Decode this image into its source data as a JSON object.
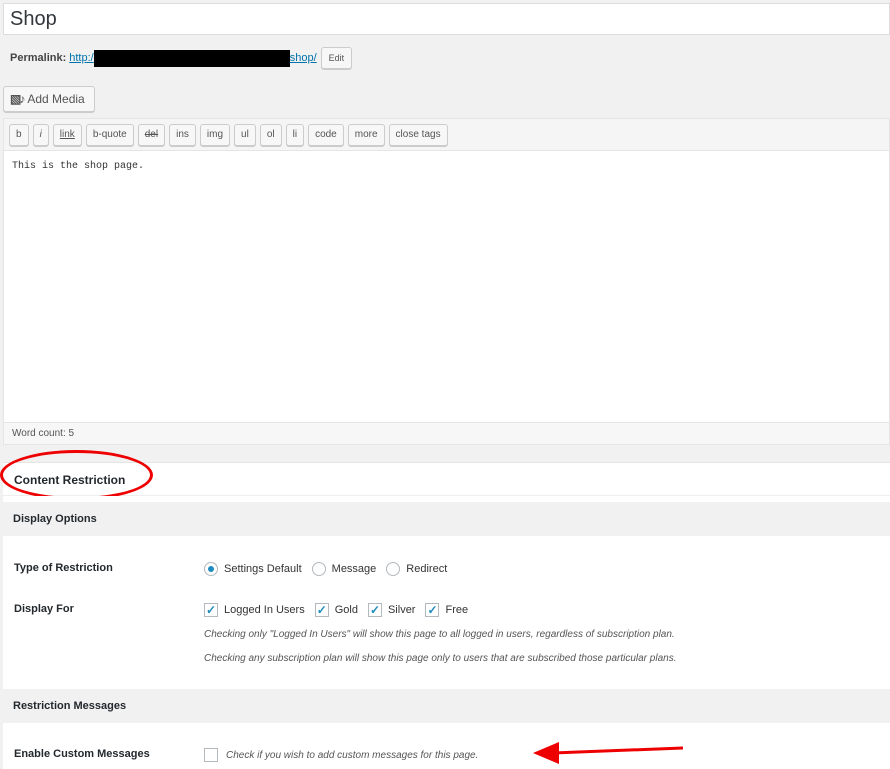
{
  "title": "Shop",
  "permalink": {
    "label": "Permalink:",
    "url_start": "http:/",
    "url_end": "shop/",
    "edit_label": "Edit"
  },
  "add_media": {
    "icon": "media-icon",
    "label": "Add Media"
  },
  "toolbar": [
    "b",
    "i",
    "link",
    "b-quote",
    "del",
    "ins",
    "img",
    "ul",
    "ol",
    "li",
    "code",
    "more",
    "close tags"
  ],
  "editor_content": "This is the shop page.",
  "word_count": "Word count: 5",
  "content_restriction": {
    "title": "Content Restriction",
    "display_options": "Display Options",
    "type_label": "Type of Restriction",
    "type_options": [
      "Settings Default",
      "Message",
      "Redirect"
    ],
    "type_selected": 0,
    "display_for_label": "Display For",
    "display_for_options": [
      "Logged In Users",
      "Gold",
      "Silver",
      "Free"
    ],
    "display_for_checked": [
      true,
      true,
      true,
      true
    ],
    "desc_1": "Checking only \"Logged In Users\" will show this page to all logged in users, regardless of subscription plan.",
    "desc_2": "Checking any subscription plan will show this page only to users that are subscribed those particular plans.",
    "restriction_messages": "Restriction Messages",
    "custom_label": "Enable Custom Messages",
    "custom_desc": "Check if you wish to add custom messages for this page.",
    "custom_checked": false
  },
  "annotation_color": "#e00000"
}
